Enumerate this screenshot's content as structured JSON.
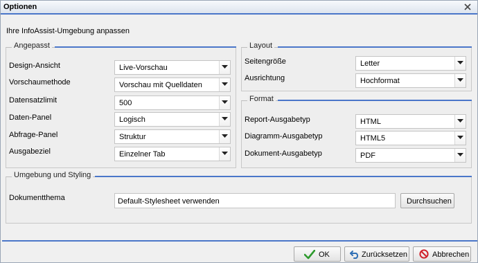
{
  "dialog": {
    "title": "Optionen",
    "subtitle": "Ihre InfoAssist-Umgebung anpassen"
  },
  "angepasst": {
    "legend": "Angepasst",
    "rows": [
      {
        "label": "Design-Ansicht",
        "value": "Live-Vorschau"
      },
      {
        "label": "Vorschaumethode",
        "value": "Vorschau mit Quelldaten"
      },
      {
        "label": "Datensatzlimit",
        "value": "500"
      },
      {
        "label": "Daten-Panel",
        "value": "Logisch"
      },
      {
        "label": "Abfrage-Panel",
        "value": "Struktur"
      },
      {
        "label": "Ausgabeziel",
        "value": "Einzelner Tab"
      }
    ]
  },
  "layout": {
    "legend": "Layout",
    "rows": [
      {
        "label": "Seitengröße",
        "value": "Letter"
      },
      {
        "label": "Ausrichtung",
        "value": "Hochformat"
      }
    ]
  },
  "format": {
    "legend": "Format",
    "rows": [
      {
        "label": "Report-Ausgabetyp",
        "value": "HTML"
      },
      {
        "label": "Diagramm-Ausgabetyp",
        "value": "HTML5"
      },
      {
        "label": "Dokument-Ausgabetyp",
        "value": "PDF"
      }
    ]
  },
  "styling": {
    "legend": "Umgebung und Styling",
    "theme_label": "Dokumentthema",
    "theme_value": "Default-Stylesheet verwenden",
    "browse_label": "Durchsuchen"
  },
  "footer": {
    "ok_label": "OK",
    "reset_label": "Zurücksetzen",
    "cancel_label": "Abbrechen"
  },
  "colors": {
    "accent": "#4a76c9",
    "ok_green": "#2e9a2e",
    "cancel_red": "#d0202a",
    "reset_blue": "#2f6fb5"
  },
  "icons": {
    "close": "close-icon",
    "ok": "checkmark-icon",
    "reset": "undo-icon",
    "cancel": "no-entry-icon",
    "dropdown": "chevron-down-icon"
  }
}
